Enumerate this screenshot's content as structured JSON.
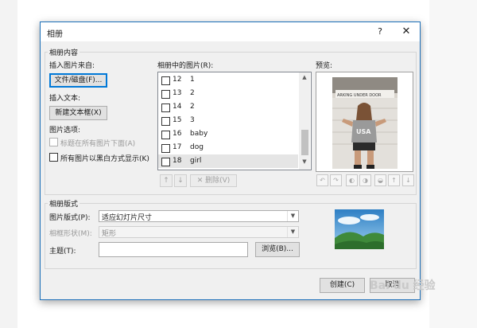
{
  "dialog": {
    "title": "相册",
    "help_label": "?",
    "close_label": "✕"
  },
  "album_content": {
    "group_label": "相册内容",
    "insert_picture_from_label": "插入图片来自:",
    "file_disk_button": "文件/磁盘(F)...",
    "insert_text_label": "插入文本:",
    "new_textbox_button": "新建文本框(X)",
    "picture_options_label": "图片选项:",
    "captions_below_label": "标题在所有图片下面(A)",
    "all_black_white_label": "所有图片以黑白方式显示(K)",
    "pictures_in_album_label": "相册中的图片(R):",
    "pictures": [
      {
        "num": "12",
        "name": "1",
        "selected": false
      },
      {
        "num": "13",
        "name": "2",
        "selected": false
      },
      {
        "num": "14",
        "name": "2",
        "selected": false
      },
      {
        "num": "15",
        "name": "3",
        "selected": false
      },
      {
        "num": "16",
        "name": "baby",
        "selected": false
      },
      {
        "num": "17",
        "name": "dog",
        "selected": false
      },
      {
        "num": "18",
        "name": "girl",
        "selected": true
      }
    ],
    "move_up_icon": "↑",
    "move_down_icon": "↓",
    "delete_button": "✕ 删除(V)",
    "preview_label": "预览:",
    "preview_sign_text": "ARKING UNDER DOOR",
    "preview_shirt_text": "USA"
  },
  "album_layout": {
    "group_label": "相册版式",
    "picture_layout_label": "图片版式(P):",
    "picture_layout_value": "适应幻灯片尺寸",
    "frame_shape_label": "相框形状(M):",
    "frame_shape_value": "矩形",
    "theme_label": "主题(T):",
    "theme_value": "",
    "browse_button": "浏览(B)..."
  },
  "footer": {
    "create_button": "创建(C)",
    "cancel_button": "取消"
  },
  "watermark": "Bai du 经验",
  "colors": {
    "accent": "#0078d7",
    "dialog_bg": "#f0f0f0",
    "selected_row": "#e5e5e5"
  }
}
